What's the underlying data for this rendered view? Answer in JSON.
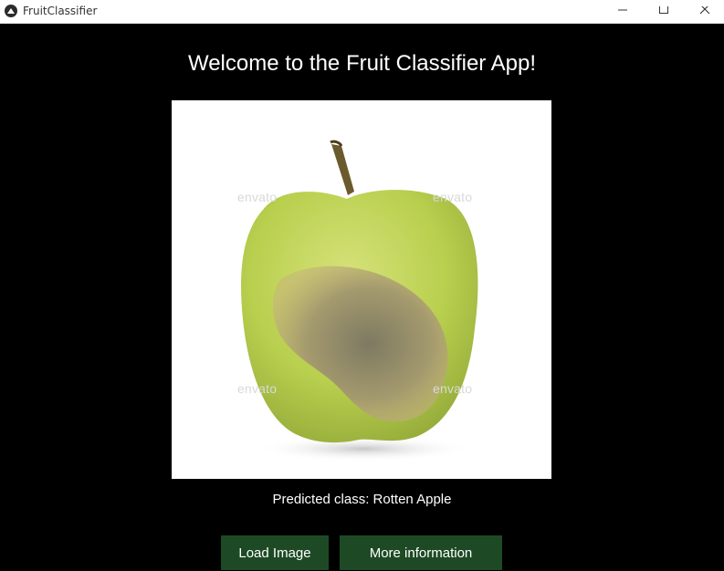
{
  "window": {
    "title": "FruitClassifier",
    "icon": "kivy-icon",
    "controls": [
      "minimize-icon",
      "maximize-icon",
      "close-icon"
    ]
  },
  "main": {
    "heading": "Welcome to the Fruit Classifier App!",
    "image": {
      "subject": "green apple with brown rotten patch on white background",
      "watermark_text": "envato"
    },
    "prediction_text": "Predicted class: Rotten Apple",
    "buttons": {
      "load_image": "Load Image",
      "more_information": "More information"
    }
  },
  "colors": {
    "background": "#000000",
    "button": "#1d4a25",
    "text": "#ffffff"
  }
}
